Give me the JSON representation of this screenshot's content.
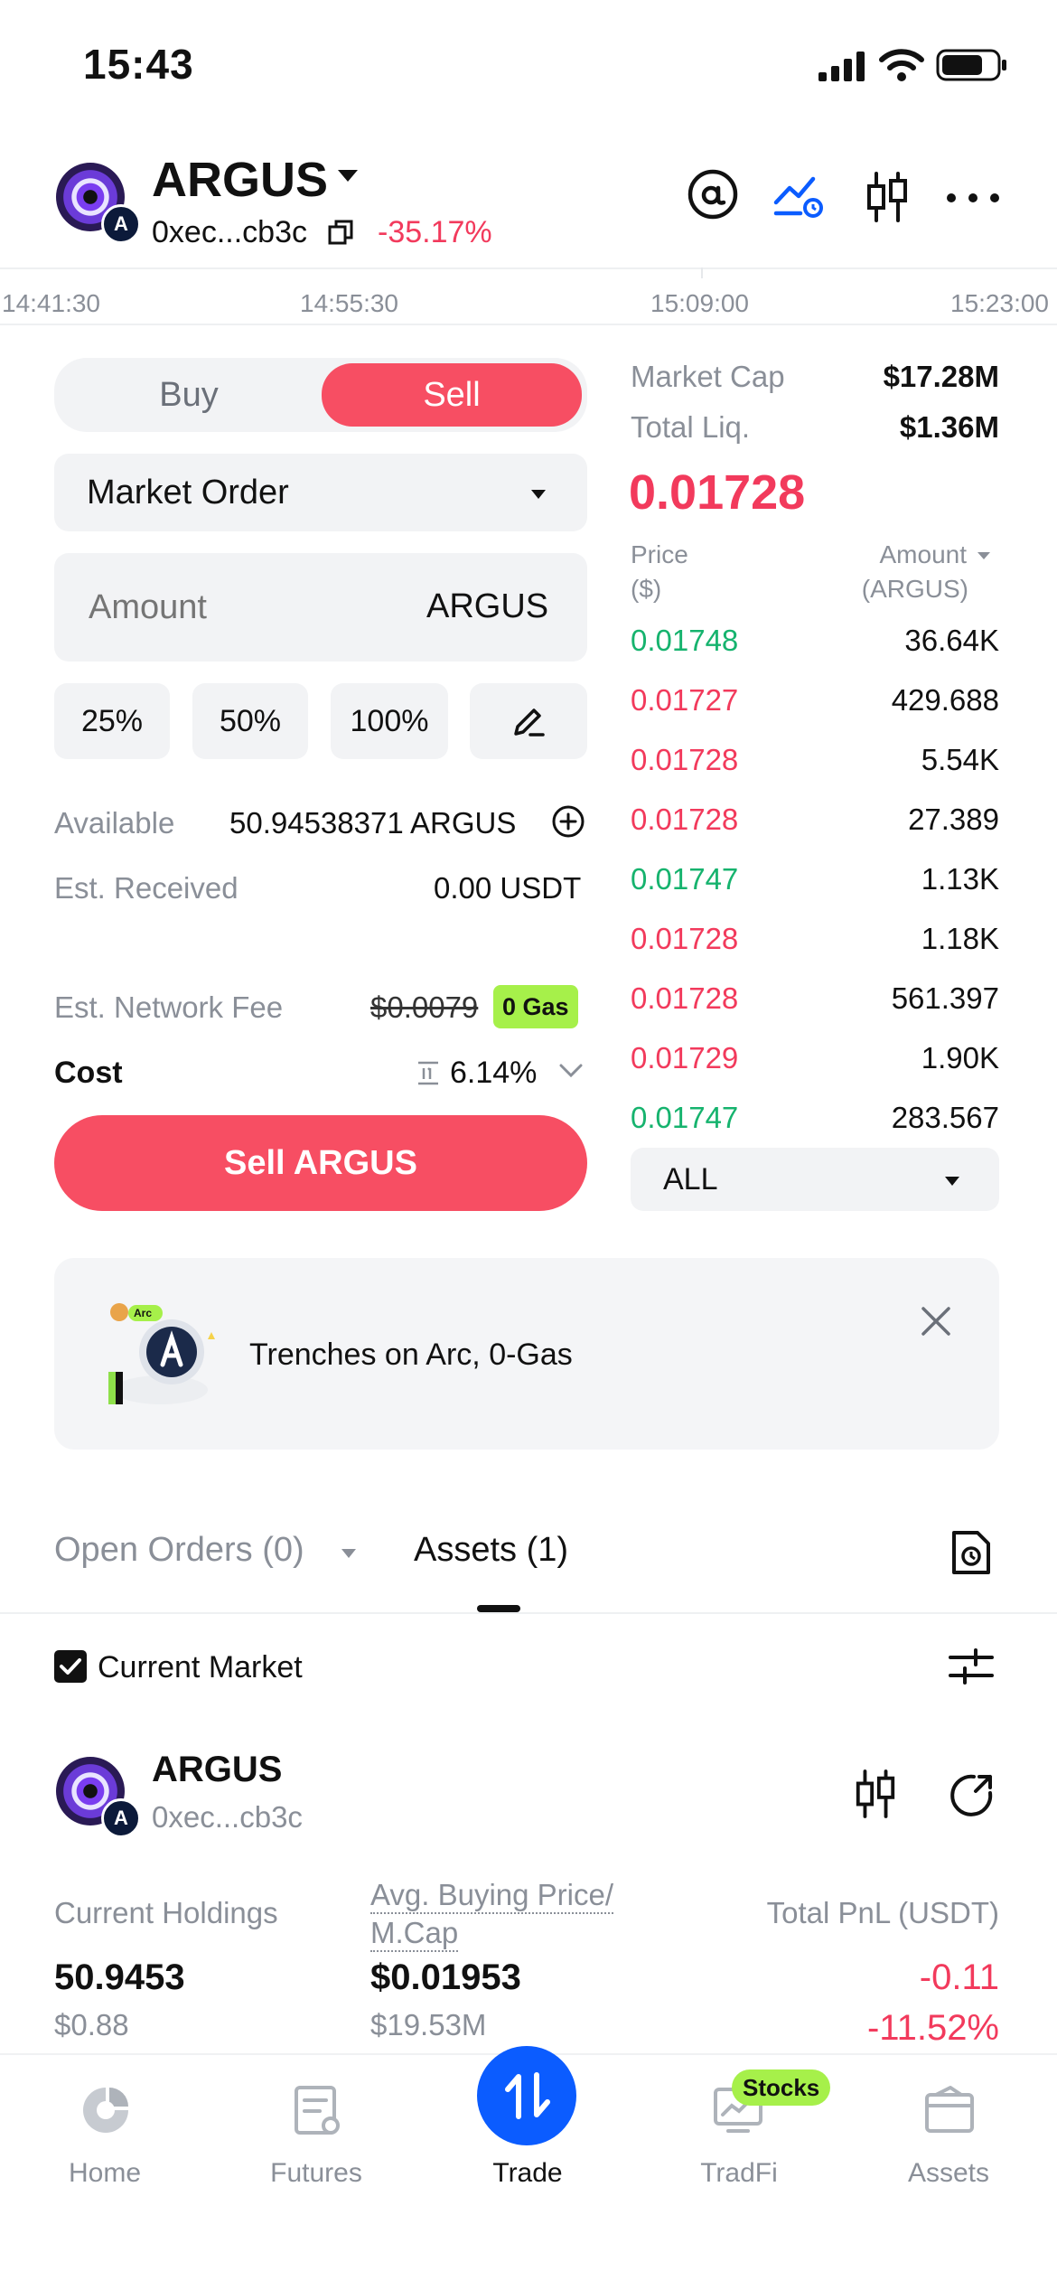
{
  "status_bar": {
    "time": "15:43"
  },
  "header": {
    "token_name": "ARGUS",
    "address": "0xec...cb3c",
    "change": "-35.17%"
  },
  "chart_axis": {
    "times": [
      "14:41:30",
      "14:55:30",
      "15:09:00",
      "15:23:00"
    ]
  },
  "trade": {
    "buy_label": "Buy",
    "sell_label": "Sell",
    "order_type": "Market Order",
    "amount_placeholder": "Amount",
    "amount_unit": "ARGUS",
    "pct_buttons": [
      "25%",
      "50%",
      "100%"
    ],
    "available_label": "Available",
    "available_value": "50.94538371 ARGUS",
    "received_label": "Est. Received",
    "received_value": "0.00 USDT",
    "fee_label": "Est. Network Fee",
    "fee_value": "$0.0079",
    "gas_badge": "0 Gas",
    "cost_label": "Cost",
    "cost_value": "6.14%",
    "sell_button": "Sell ARGUS"
  },
  "market": {
    "cap_label": "Market Cap",
    "cap_value": "$17.28M",
    "liq_label": "Total Liq.",
    "liq_value": "$1.36M",
    "price": "0.01728",
    "price_header_1": "Price",
    "price_header_2": "($)",
    "amount_header_1": "Amount",
    "amount_header_2": "(ARGUS)",
    "filter": "ALL",
    "rows": [
      {
        "price": "0.01748",
        "amount": "36.64K",
        "side": "buy"
      },
      {
        "price": "0.01727",
        "amount": "429.688",
        "side": "sell"
      },
      {
        "price": "0.01728",
        "amount": "5.54K",
        "side": "sell"
      },
      {
        "price": "0.01728",
        "amount": "27.389",
        "side": "sell"
      },
      {
        "price": "0.01747",
        "amount": "1.13K",
        "side": "buy"
      },
      {
        "price": "0.01728",
        "amount": "1.18K",
        "side": "sell"
      },
      {
        "price": "0.01728",
        "amount": "561.397",
        "side": "sell"
      },
      {
        "price": "0.01729",
        "amount": "1.90K",
        "side": "sell"
      },
      {
        "price": "0.01747",
        "amount": "283.567",
        "side": "buy"
      }
    ]
  },
  "banner": {
    "badge": "Arc",
    "text": "Trenches on Arc, 0-Gas"
  },
  "tabs": {
    "open_orders": "Open Orders (0)",
    "assets": "Assets (1)"
  },
  "filter_row": {
    "current_market": "Current Market"
  },
  "asset": {
    "name": "ARGUS",
    "address": "0xec...cb3c",
    "holdings_label": "Current Holdings",
    "avg_label_1": "Avg. Buying Price/",
    "avg_label_2": "M.Cap",
    "pnl_label": "Total PnL (USDT)",
    "holdings_value": "50.9453",
    "holdings_usd": "$0.88",
    "avg_price": "$0.01953",
    "avg_mcap": "$19.53M",
    "pnl_value": "-0.11",
    "pnl_pct": "-11.52%"
  },
  "bottom_nav": {
    "home": "Home",
    "futures": "Futures",
    "trade": "Trade",
    "tradfi": "TradFi",
    "stocks_badge": "Stocks",
    "assets": "Assets"
  },
  "colors": {
    "sell": "#f74e63",
    "buy": "#16b36e",
    "accent": "#0b5cff",
    "gas": "#a6f04a"
  }
}
